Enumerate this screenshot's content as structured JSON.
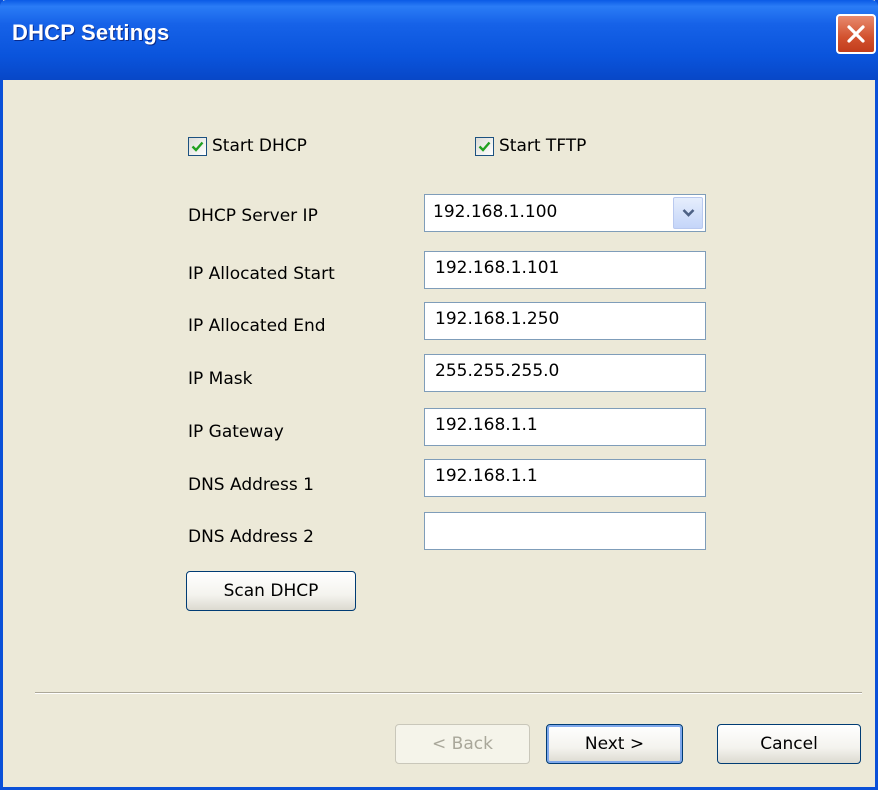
{
  "window": {
    "title": "DHCP Settings"
  },
  "options": {
    "start_dhcp": {
      "label": "Start DHCP",
      "checked": true
    },
    "start_tftp": {
      "label": "Start TFTP",
      "checked": true
    }
  },
  "fields": {
    "dhcp_server_ip": {
      "label": "DHCP Server IP",
      "value": "192.168.1.100"
    },
    "ip_allocated_start": {
      "label": "IP Allocated Start",
      "value": "192.168.1.101"
    },
    "ip_allocated_end": {
      "label": "IP Allocated End",
      "value": "192.168.1.250"
    },
    "ip_mask": {
      "label": "IP Mask",
      "value": "255.255.255.0"
    },
    "ip_gateway": {
      "label": "IP Gateway",
      "value": "192.168.1.1"
    },
    "dns_address_1": {
      "label": "DNS Address 1",
      "value": "192.168.1.1"
    },
    "dns_address_2": {
      "label": "DNS Address 2",
      "value": ""
    }
  },
  "buttons": {
    "scan_dhcp": "Scan DHCP",
    "back": "< Back",
    "next": "Next >",
    "cancel": "Cancel"
  },
  "icons": {
    "close": "close-icon",
    "check": "checkmark-icon",
    "dropdown": "chevron-down-icon"
  },
  "colors": {
    "titlebar": "#0a54dc",
    "dialog_background": "#ece9d8",
    "close_button": "#d2512e",
    "checkmark": "#21a121",
    "input_border": "#7f9db9"
  }
}
